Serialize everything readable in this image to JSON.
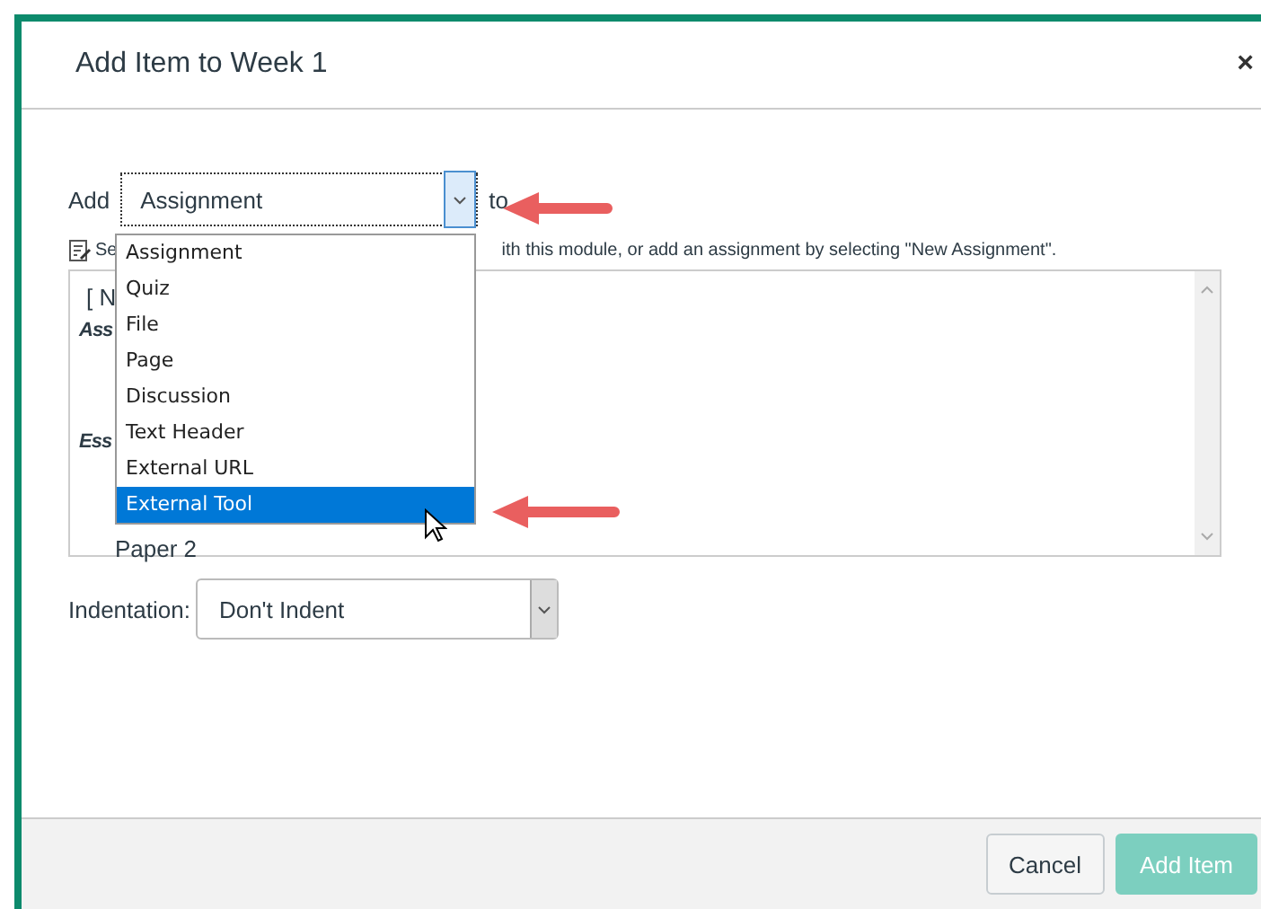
{
  "dialog": {
    "title": "Add Item to Week 1",
    "close": "×"
  },
  "add_row": {
    "label": "Add",
    "select": {
      "value": "Assignment",
      "expanded": true
    },
    "after": "to"
  },
  "dropdown": {
    "options": [
      {
        "label": "Assignment",
        "selected": false
      },
      {
        "label": "Quiz",
        "selected": false
      },
      {
        "label": "File",
        "selected": false
      },
      {
        "label": "Page",
        "selected": false
      },
      {
        "label": "Discussion",
        "selected": false
      },
      {
        "label": "Text Header",
        "selected": false
      },
      {
        "label": "External URL",
        "selected": false
      },
      {
        "label": "External Tool",
        "selected": true
      }
    ]
  },
  "help": {
    "start": "Se",
    "end": "ith this module, or add an assignment by selecting \"New Assignment\"."
  },
  "item_list": {
    "entries": [
      {
        "text": "[ N",
        "kind": "plain"
      },
      {
        "text": "Ass",
        "kind": "group"
      },
      {
        "text": "Ess",
        "kind": "group"
      },
      {
        "text": "Paper 2",
        "kind": "item"
      }
    ]
  },
  "indentation": {
    "label": "Indentation:",
    "value": "Don't Indent"
  },
  "buttons": [
    {
      "label": "Cancel",
      "kind": "secondary",
      "disabled": false
    },
    {
      "label": "Add Item",
      "kind": "primary",
      "disabled": true
    }
  ]
}
